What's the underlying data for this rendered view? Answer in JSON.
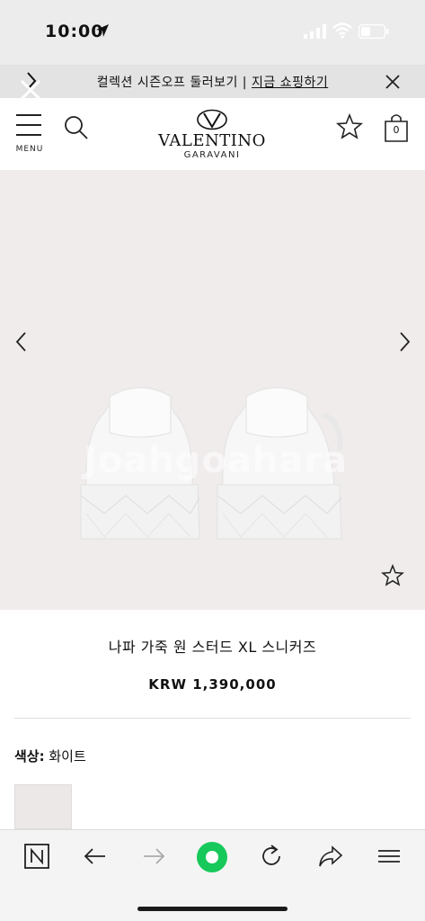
{
  "status_bar": {
    "time": "10:00"
  },
  "promo": {
    "text_main": "컬렉션 시즌오프 둘러보기 | ",
    "text_link": "지금 쇼핑하기"
  },
  "header": {
    "menu_label": "MENU",
    "brand": "VALENTINO",
    "brand_sub": "GARAVANI",
    "bag_count": "0"
  },
  "gallery": {
    "watermark": "Joahgoahara"
  },
  "product": {
    "title": "나파 가죽 원 스터드 XL 스니커즈",
    "price": "KRW 1,390,000",
    "color_label": "색상:",
    "color_value": " 화이트"
  },
  "icons": {
    "accent": "#16c95a"
  }
}
